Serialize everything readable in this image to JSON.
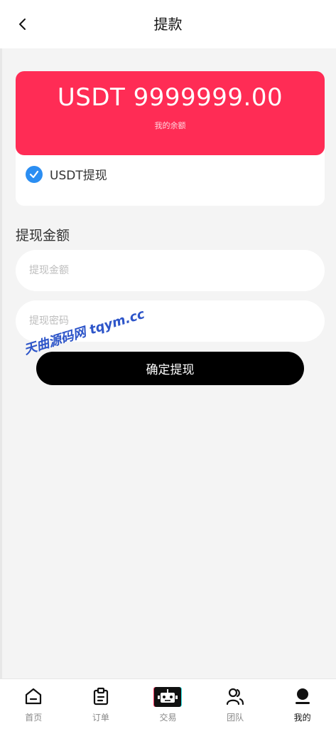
{
  "header": {
    "title": "提款"
  },
  "balance": {
    "amount": "USDT 9999999.00",
    "label": "我的余额"
  },
  "method": {
    "label": "USDT提现",
    "checked": true
  },
  "form": {
    "section_title": "提现金额",
    "amount_placeholder": "提现金额",
    "amount_value": "",
    "password_placeholder": "提现密码",
    "password_value": "",
    "submit_label": "确定提现"
  },
  "watermark": "天曲源码网 tqym.cc",
  "tabbar": {
    "items": [
      {
        "label": "首页",
        "icon": "home-icon"
      },
      {
        "label": "订单",
        "icon": "clipboard-icon"
      },
      {
        "label": "交易",
        "icon": "robot-icon"
      },
      {
        "label": "团队",
        "icon": "team-icon"
      },
      {
        "label": "我的",
        "icon": "user-icon",
        "active": true
      }
    ]
  },
  "colors": {
    "accent": "#ff2c55",
    "check": "#2b8ef2",
    "button": "#000000",
    "background": "#f4f4f4"
  }
}
